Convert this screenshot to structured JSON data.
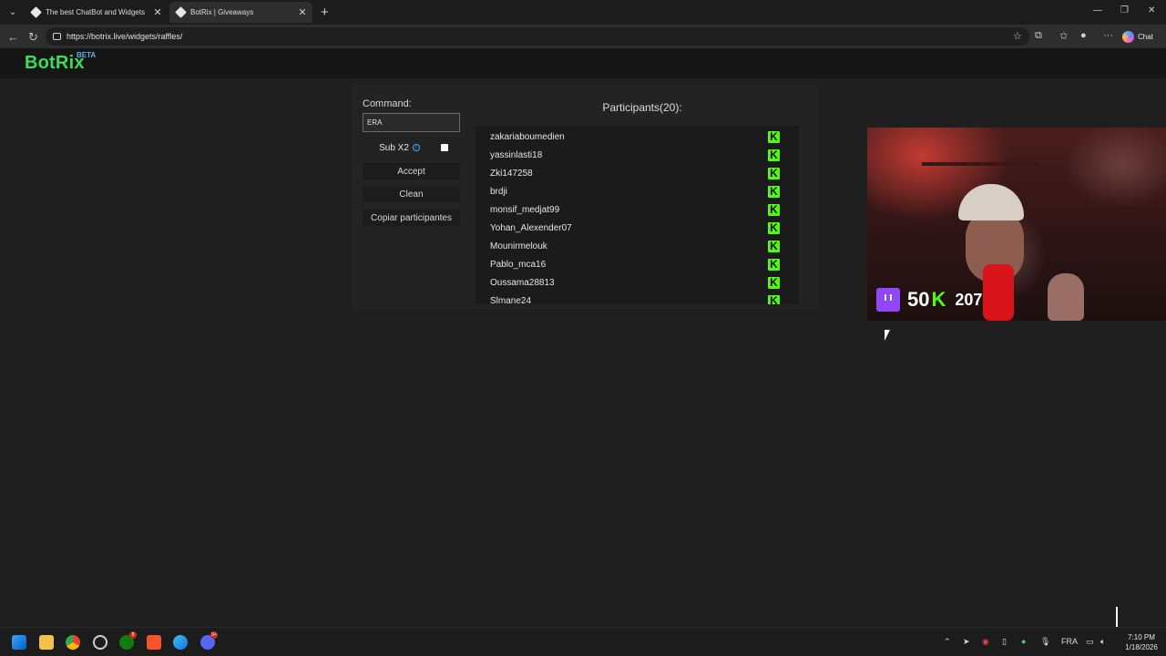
{
  "browser": {
    "tabs": [
      {
        "title": "The best ChatBot and Widgets for"
      },
      {
        "title": "BotRix | Giveaways"
      }
    ],
    "url": "https://botrix.live/widgets/raffles/",
    "chat_label": "Chat"
  },
  "site": {
    "brand": "BotRix",
    "badge": "BETA"
  },
  "raffle": {
    "command_label": "Command:",
    "command_value": "ERA",
    "sub_label": "Sub X2",
    "sub_checked": false,
    "buttons": {
      "accept": "Accept",
      "clean": "Clean",
      "copy": "Copiar participantes"
    },
    "participants_title": "Participants(20):",
    "participants": [
      "zakariaboumedien",
      "yassinlasti18",
      "Zki147258",
      "brdji",
      "monsif_medjat99",
      "Yohan_Alexender07",
      "Mounirmelouk",
      "Pablo_mca16",
      "Oussama28813",
      "Slmane24"
    ],
    "platform_icon": "kick-icon",
    "platform_color": "#53fc18"
  },
  "stream": {
    "followers_text": "50",
    "followers_suffix": "K",
    "viewers": "207",
    "platform_icon": "twitch-icon",
    "platform_color": "#9146ff"
  },
  "taskbar": {
    "language": "FRA",
    "time": "7:10 PM",
    "date": "1/18/2026",
    "xbox_badge": "8",
    "discord_badge": "9+"
  }
}
